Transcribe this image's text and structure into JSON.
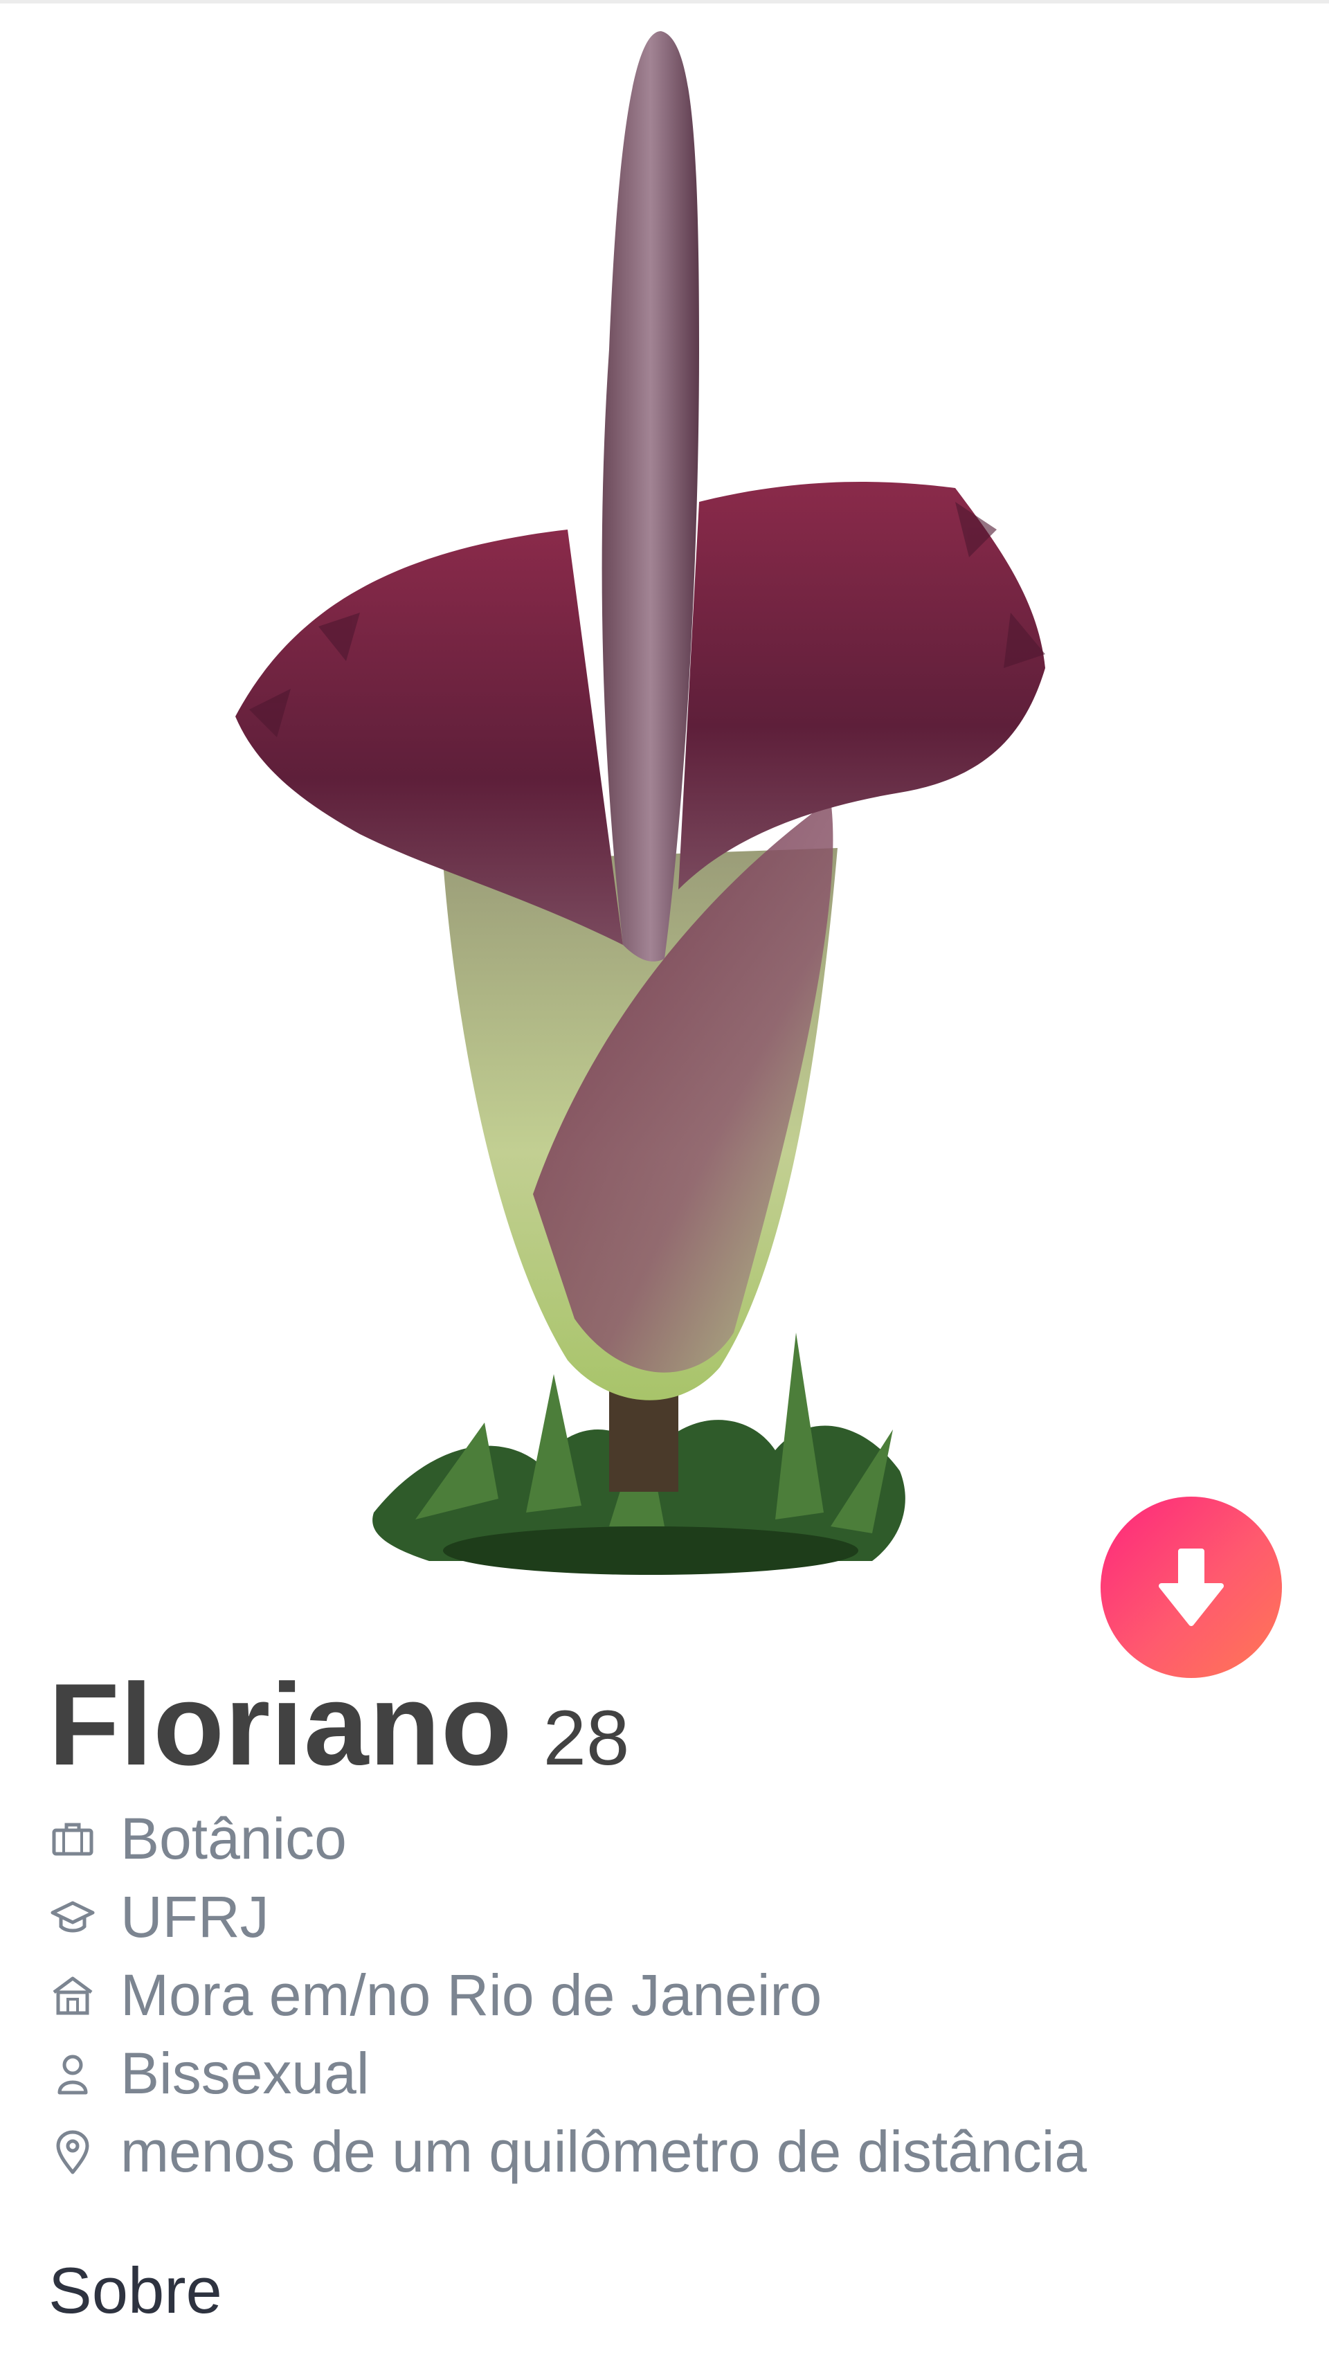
{
  "profile": {
    "name": "Floriano",
    "age": "28",
    "details": [
      {
        "icon": "briefcase-icon",
        "text": "Botânico"
      },
      {
        "icon": "graduation-cap-icon",
        "text": "UFRJ"
      },
      {
        "icon": "home-icon",
        "text": "Mora em/no Rio de Janeiro"
      },
      {
        "icon": "person-icon",
        "text": "Bissexual"
      },
      {
        "icon": "location-pin-icon",
        "text": "menos de um quilômetro de distância"
      }
    ]
  },
  "sections": {
    "about_title": "Sobre"
  },
  "actions": {
    "collapse_icon": "arrow-down-icon"
  },
  "colors": {
    "accent_start": "#fd267d",
    "accent_end": "#ff7854",
    "text_dark": "#424242",
    "text_muted": "#7c8591"
  }
}
